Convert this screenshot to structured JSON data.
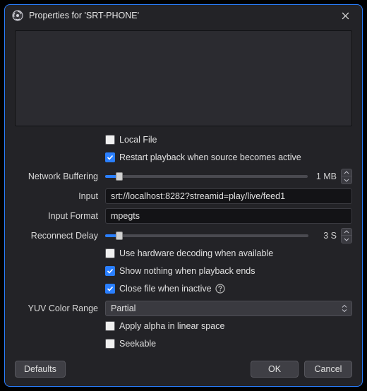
{
  "title": "Properties for 'SRT-PHONE'",
  "fields": {
    "local_file": {
      "label": "Local File",
      "checked": false
    },
    "restart_active": {
      "label": "Restart playback when source becomes active",
      "checked": true
    },
    "net_buffer": {
      "label": "Network Buffering",
      "value_text": "1 MB",
      "pct": 7
    },
    "input": {
      "label": "Input",
      "value": "srt://localhost:8282?streamid=play/live/feed1"
    },
    "input_format": {
      "label": "Input Format",
      "value": "mpegts"
    },
    "reconnect_delay": {
      "label": "Reconnect Delay",
      "value_text": "3 S",
      "pct": 7
    },
    "hw_decode": {
      "label": "Use hardware decoding when available",
      "checked": false
    },
    "show_nothing": {
      "label": "Show nothing when playback ends",
      "checked": true
    },
    "close_inactive": {
      "label": "Close file when inactive",
      "checked": true
    },
    "yuv_range": {
      "label": "YUV Color Range",
      "value": "Partial"
    },
    "linear_alpha": {
      "label": "Apply alpha in linear space",
      "checked": false
    },
    "seekable": {
      "label": "Seekable",
      "checked": false
    }
  },
  "buttons": {
    "defaults": "Defaults",
    "ok": "OK",
    "cancel": "Cancel"
  }
}
